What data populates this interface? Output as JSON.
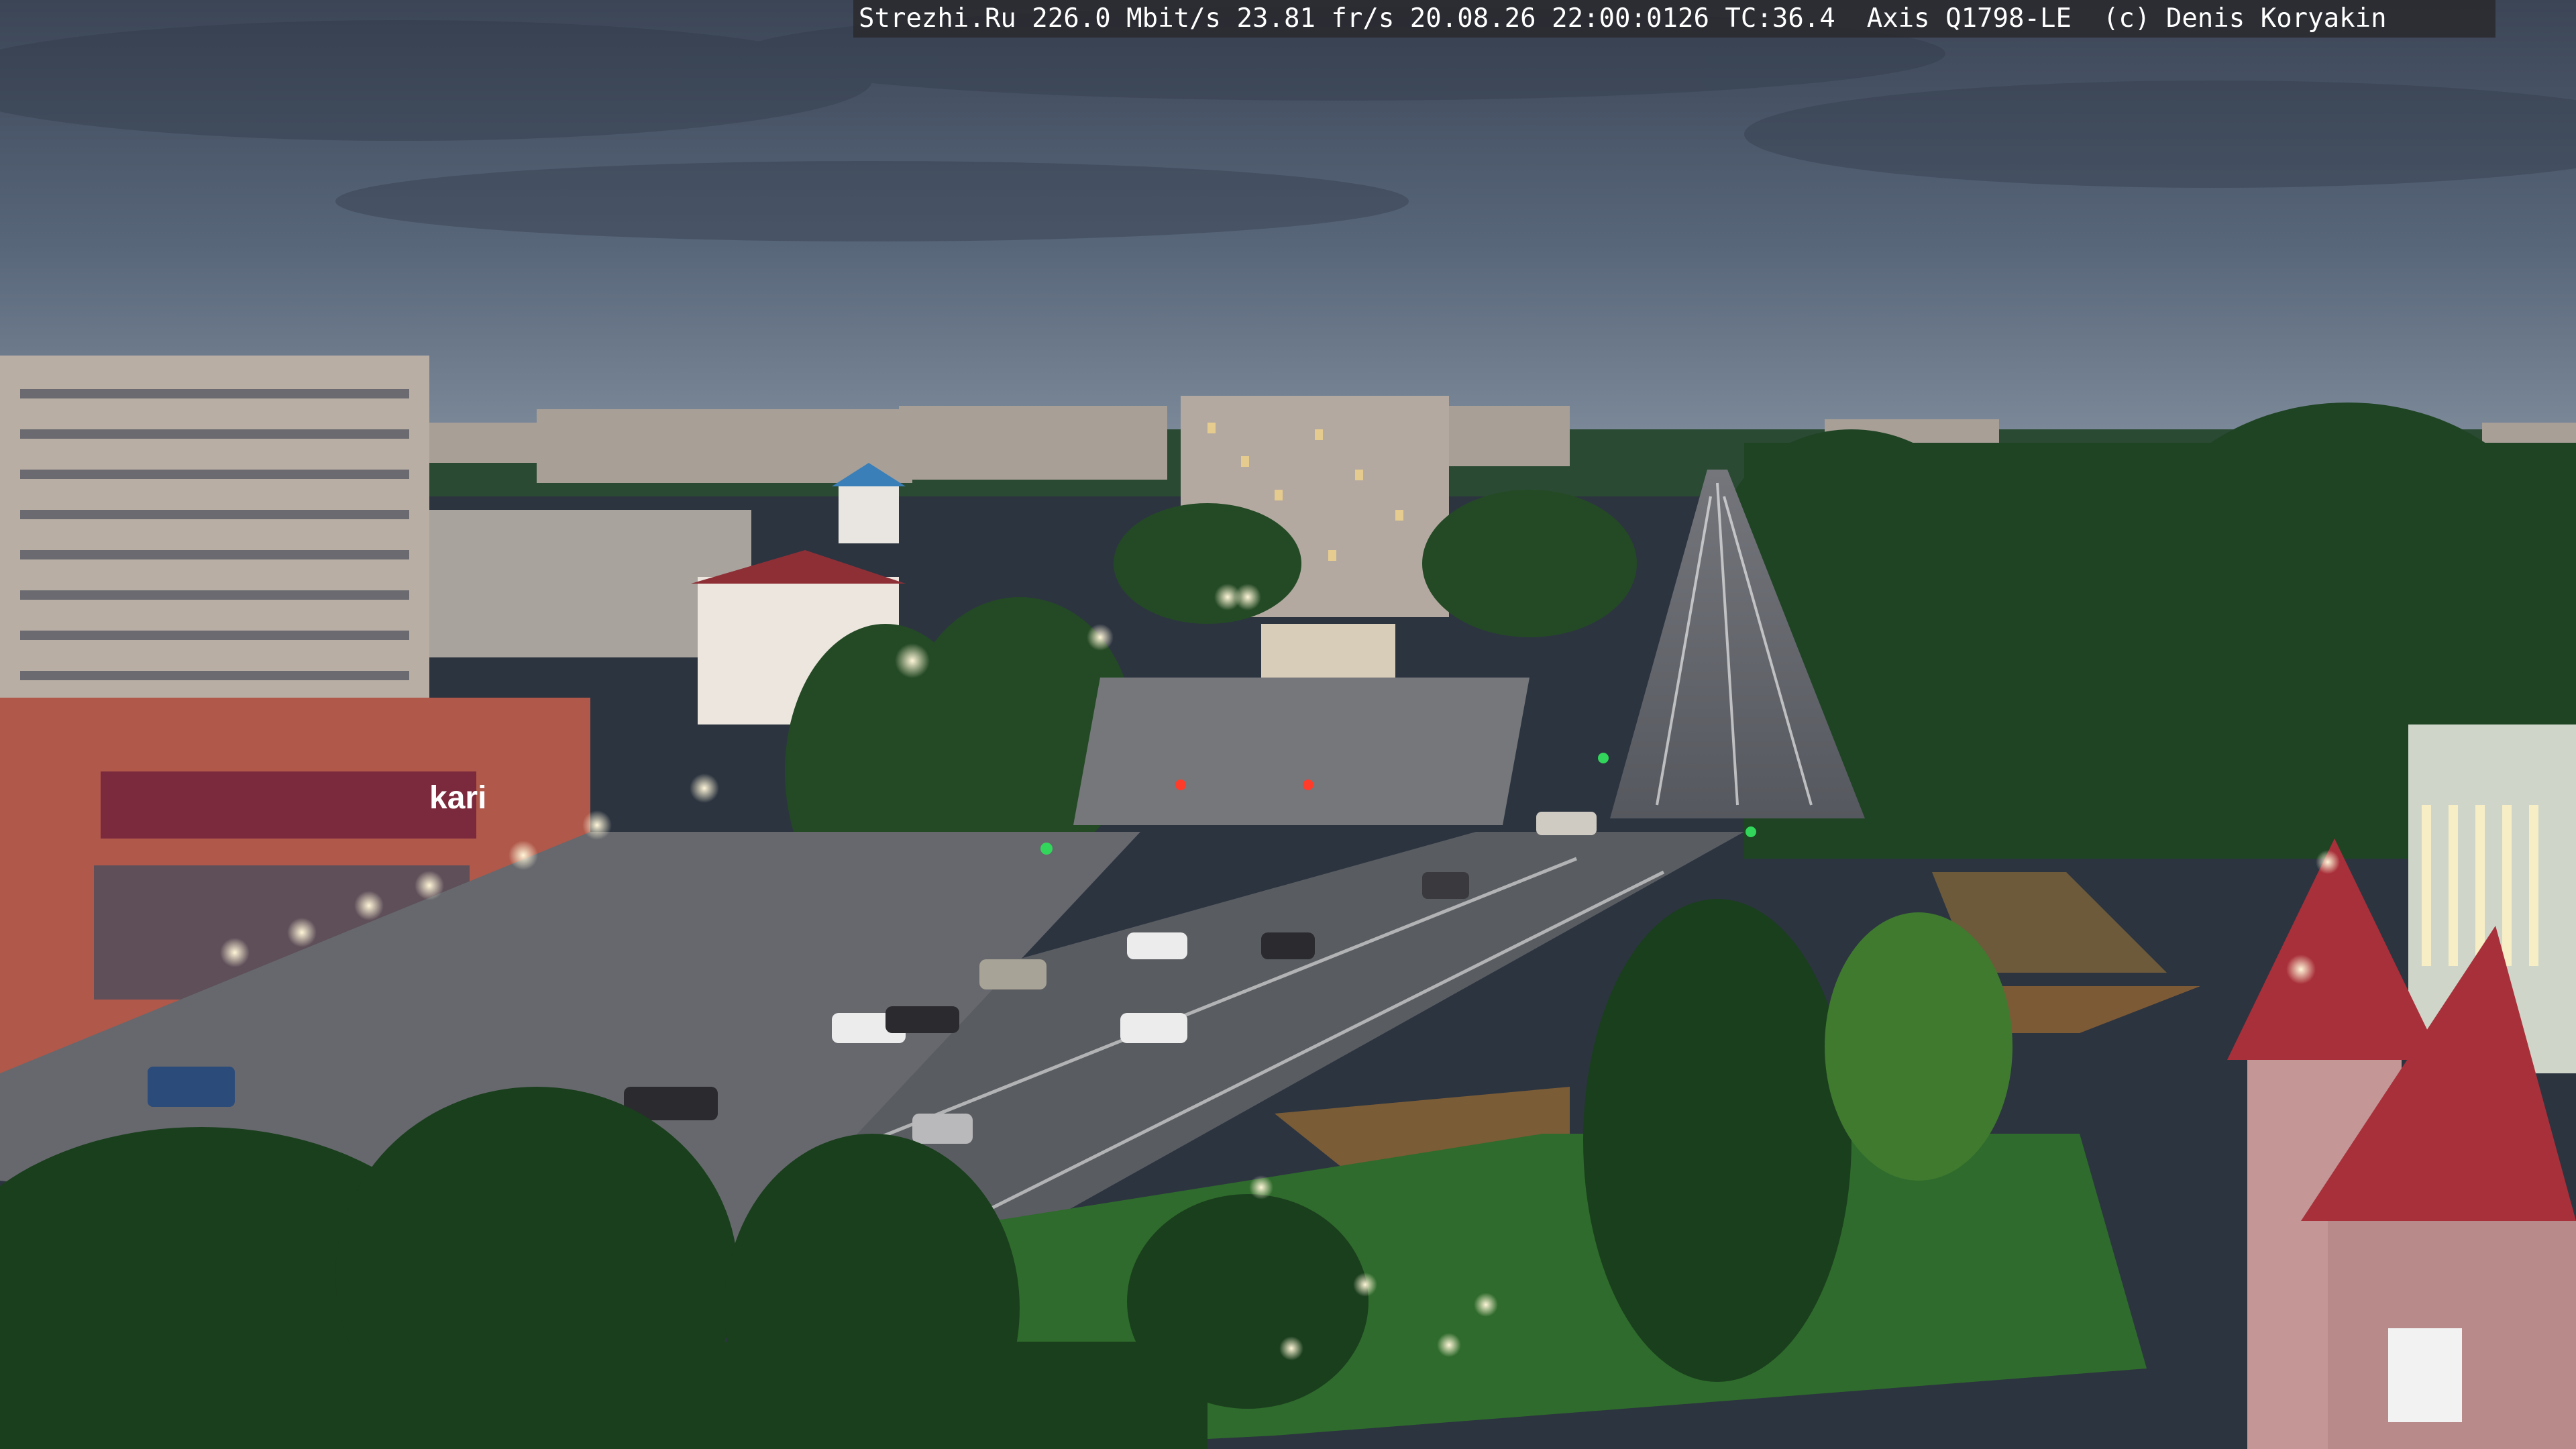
{
  "overlay": {
    "text": "Strezhi.Ru 226.0 Mbit/s 23.81 fr/s 20.08.26 22:00:0126 TC:36.4  Axis Q1798-LE  (c) Denis Koryakin"
  },
  "signs": {
    "store_brand": "kari"
  },
  "colors": {
    "sky_top": "#3d4859",
    "sky_bottom": "#6f7c8d",
    "foliage": "#244a25",
    "asphalt": "#5a5d63",
    "roof_red": "#a8303a",
    "facade_orange": "#b0584a"
  }
}
